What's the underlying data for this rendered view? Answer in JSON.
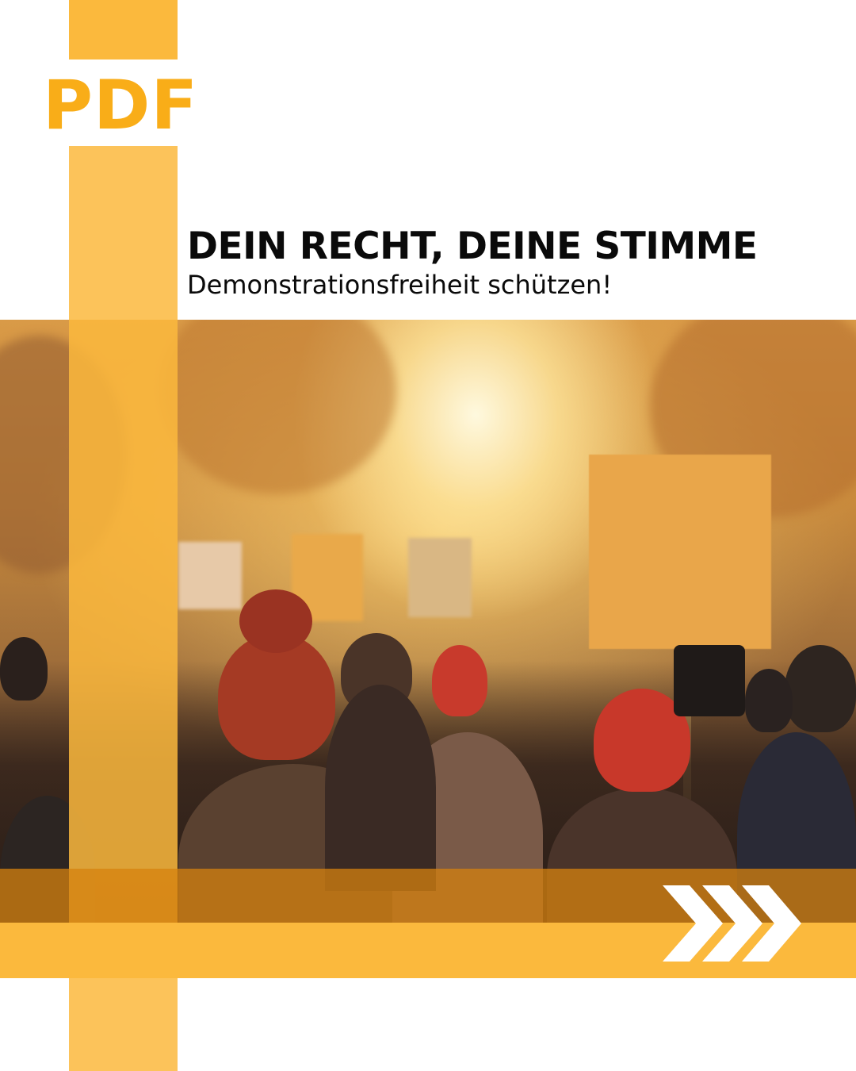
{
  "logo": {
    "text": "PDF",
    "color": "#f9ad18"
  },
  "headline": "DEIN RECHT, DEINE STIMME",
  "subline": "Demonstrationsfreiheit schützen!",
  "colors": {
    "accent": "#fbb93d",
    "accent_dark": "#d6820f",
    "text": "#0a0a0a",
    "background": "#ffffff"
  },
  "photo": {
    "subject": ""
  },
  "decor": {
    "arrows_icon": "triple-chevron-right-icon"
  }
}
